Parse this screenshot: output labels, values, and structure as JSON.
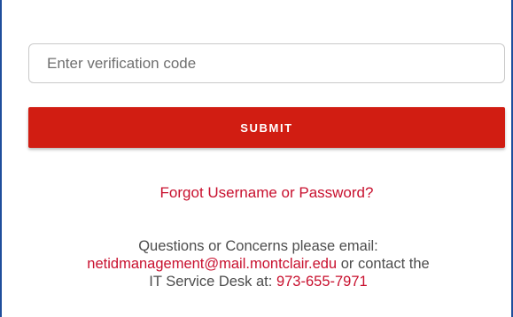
{
  "form": {
    "code_placeholder": "Enter verification code",
    "code_value": "",
    "submit_label": "SUBMIT"
  },
  "links": {
    "forgot": "Forgot Username or Password?"
  },
  "help": {
    "line1": "Questions or Concerns please email:",
    "email": "netidmanagement@mail.montclair.edu",
    "mid": " or contact the",
    "line3_prefix": "IT Service Desk at: ",
    "phone": "973-655-7971"
  },
  "colors": {
    "accent": "#d11d12",
    "link": "#c8102e",
    "frame_border": "#1f4e9c",
    "text": "#4d4d4d"
  }
}
